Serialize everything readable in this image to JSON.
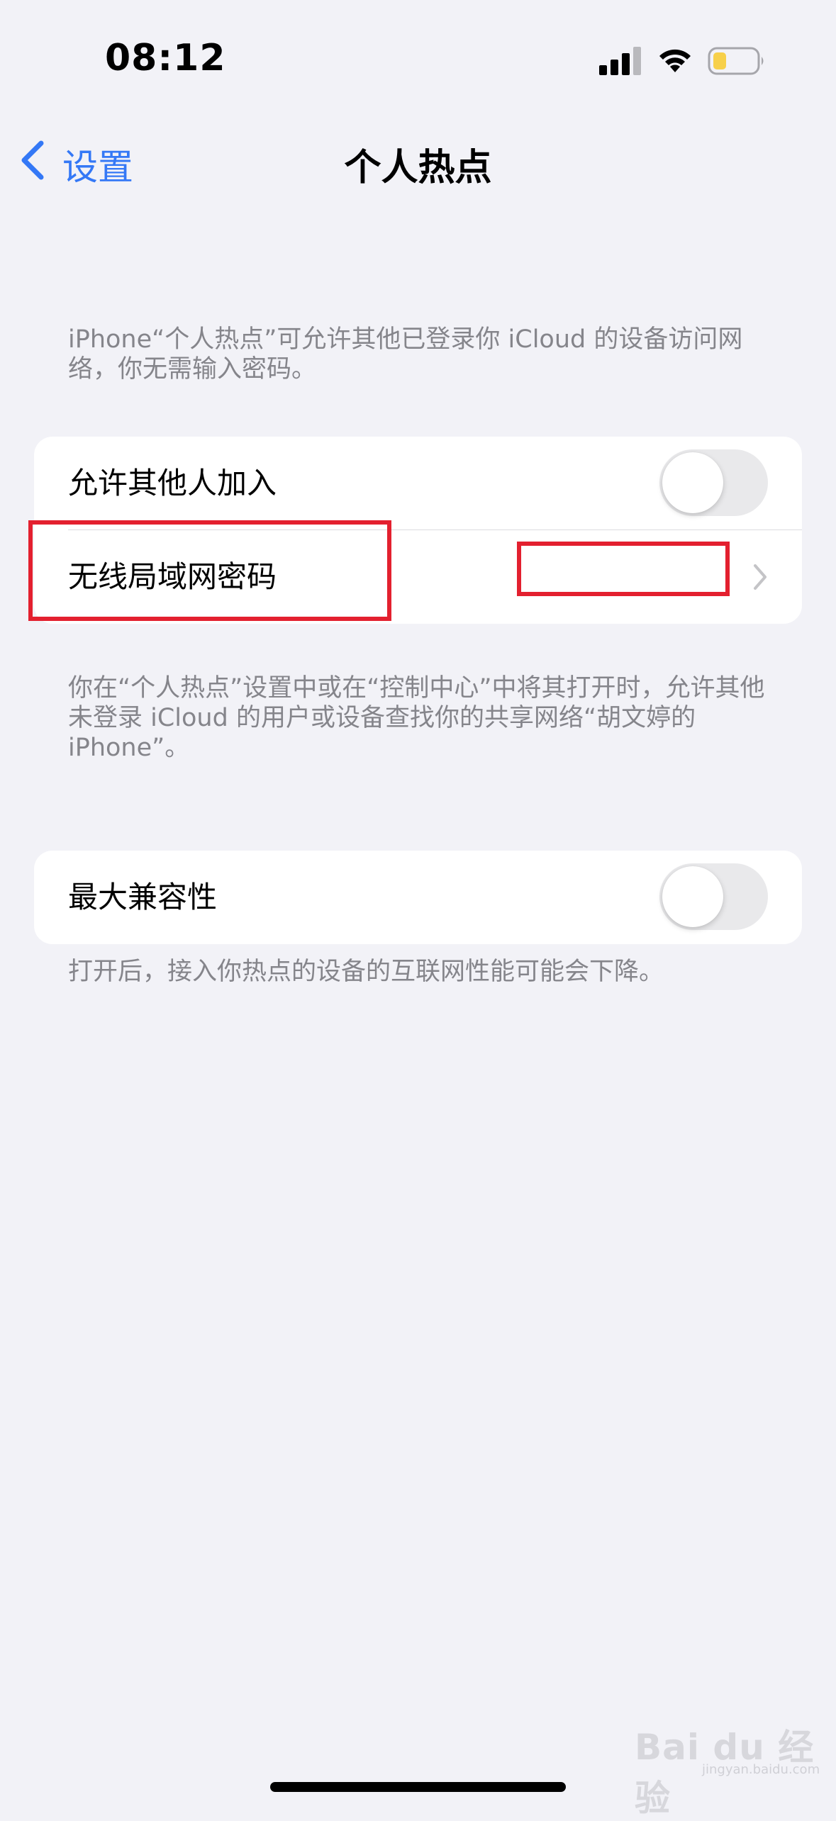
{
  "status_bar": {
    "time": "08:12",
    "icons": [
      "cellular-signal-icon",
      "wifi-icon",
      "battery-icon"
    ],
    "battery_color": "#f7d04a"
  },
  "nav": {
    "back_label": "设置",
    "title": "个人热点",
    "accent_color": "#3478f6"
  },
  "intro_text": "iPhone“个人热点”可允许其他已登录你 iCloud 的设备访问网络，你无需输入密码。",
  "group1": {
    "allow_others": {
      "label": "允许其他人加入",
      "enabled": false
    },
    "wifi_password": {
      "label": "无线局域网密码",
      "value": "",
      "icon": "chevron-right-icon"
    }
  },
  "group1_footer": "你在“个人热点”设置中或在“控制中心”中将其打开时，允许其他未登录 iCloud 的用户或设备查找你的共享网络“胡文婷的 iPhone”。",
  "group2": {
    "max_compat": {
      "label": "最大兼容性",
      "enabled": false
    }
  },
  "group2_footer": "打开后，接入你热点的设备的互联网性能可能会下降。",
  "annotation_color": "#e3202f",
  "watermark": {
    "main": "Bai du 经验",
    "sub": "jingyan.baidu.com"
  }
}
